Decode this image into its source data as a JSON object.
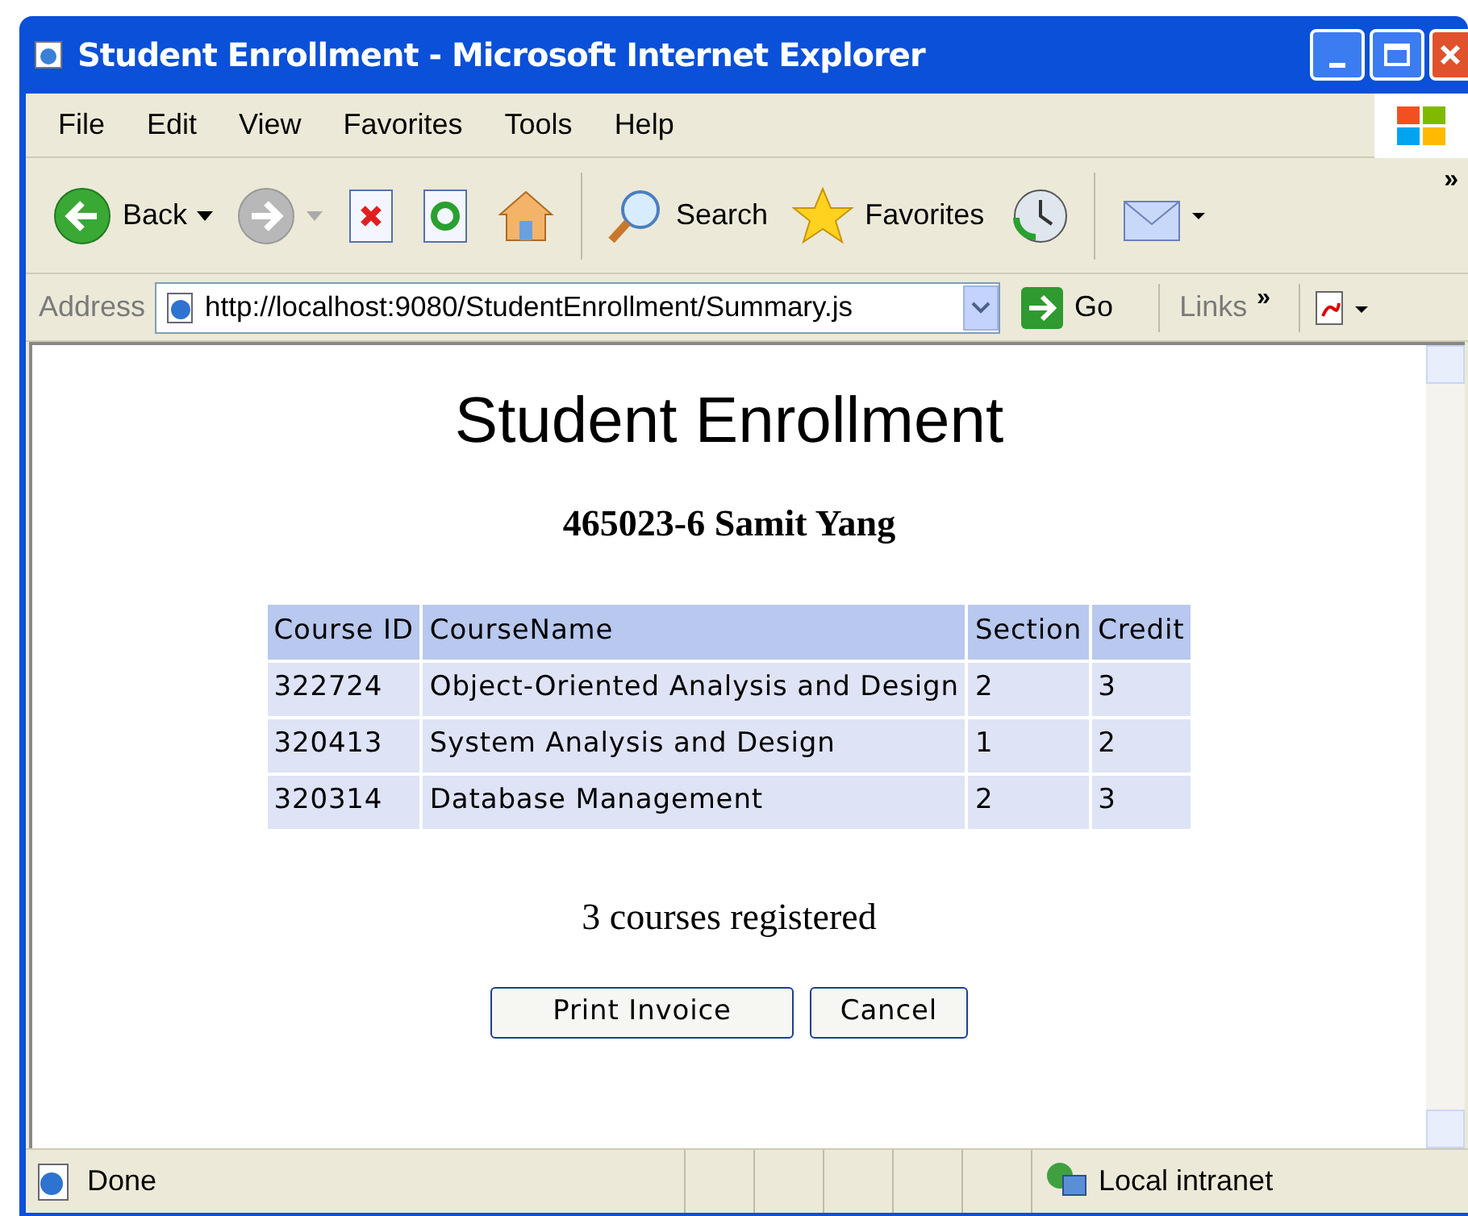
{
  "window": {
    "title": "Student Enrollment - Microsoft Internet Explorer"
  },
  "menu": [
    "File",
    "Edit",
    "View",
    "Favorites",
    "Tools",
    "Help"
  ],
  "toolbar": [
    {
      "kind": "back",
      "label": "Back"
    },
    {
      "kind": "forward"
    },
    {
      "kind": "stop"
    },
    {
      "kind": "refresh"
    },
    {
      "kind": "home"
    },
    {
      "kind": "search",
      "label": "Search"
    },
    {
      "kind": "favorites",
      "label": "Favorites"
    },
    {
      "kind": "history"
    },
    {
      "kind": "mail"
    }
  ],
  "toolbar_more": "»",
  "address_bar": {
    "label": "Address",
    "url": "http://localhost:9080/StudentEnrollment/Summary.js",
    "go": "Go",
    "links": "Links",
    "links_more": "»"
  },
  "page": {
    "heading": "Student Enrollment",
    "student": "465023-6 Samit Yang",
    "table": {
      "columns": [
        "Course ID",
        "CourseName",
        "Section",
        "Credit"
      ],
      "rows": [
        [
          "322724",
          "Object-Oriented Analysis and Design",
          "2",
          "3"
        ],
        [
          "320413",
          "System Analysis and Design",
          "1",
          "2"
        ],
        [
          "320314",
          "Database Management",
          "2",
          "3"
        ]
      ]
    },
    "summary": "3 courses registered",
    "buttons": [
      "Print Invoice",
      "Cancel"
    ]
  },
  "status_bar": {
    "text": "Done",
    "zone": "Local intranet"
  }
}
